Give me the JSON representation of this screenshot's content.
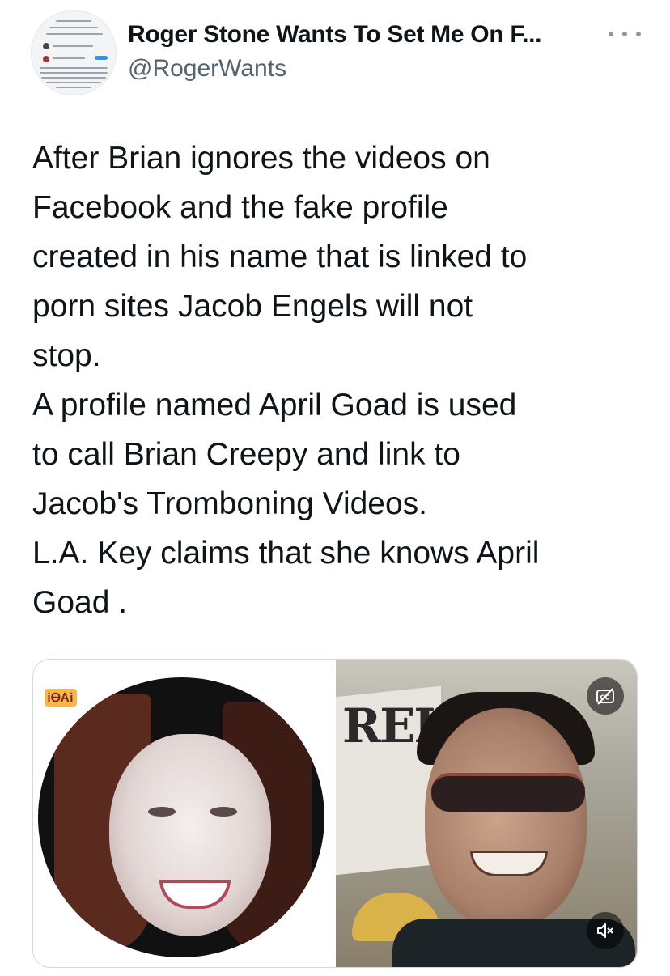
{
  "author": {
    "display_name": "Roger Stone Wants To Set Me On F...",
    "handle": "@RogerWants",
    "avatar_icon": "profile-screenshot-avatar"
  },
  "header": {
    "more_icon": "more-horizontal-icon"
  },
  "tweet": {
    "lines": [
      "After Brian ignores the videos on",
      "Facebook and the fake profile",
      "created in his name that is linked to",
      "porn sites Jacob Engels will not",
      "stop.",
      "A profile named April Goad is used",
      "to call Brian Creepy and link to",
      "Jacob's Tromboning Videos.",
      "L.A. Key claims that she knows April",
      "Goad ."
    ]
  },
  "media": {
    "logo_text": "ᎥᎾᎪᎥ",
    "banner_text": "REI",
    "captions_icon": "closed-captions-off-icon",
    "mute_icon": "volume-muted-icon",
    "colors": {
      "overlay_button": "#000000",
      "border": "#cfd9de"
    }
  },
  "colors": {
    "primary_text": "#0f1419",
    "secondary_text": "#536471",
    "accent": "#1d9bf0"
  }
}
